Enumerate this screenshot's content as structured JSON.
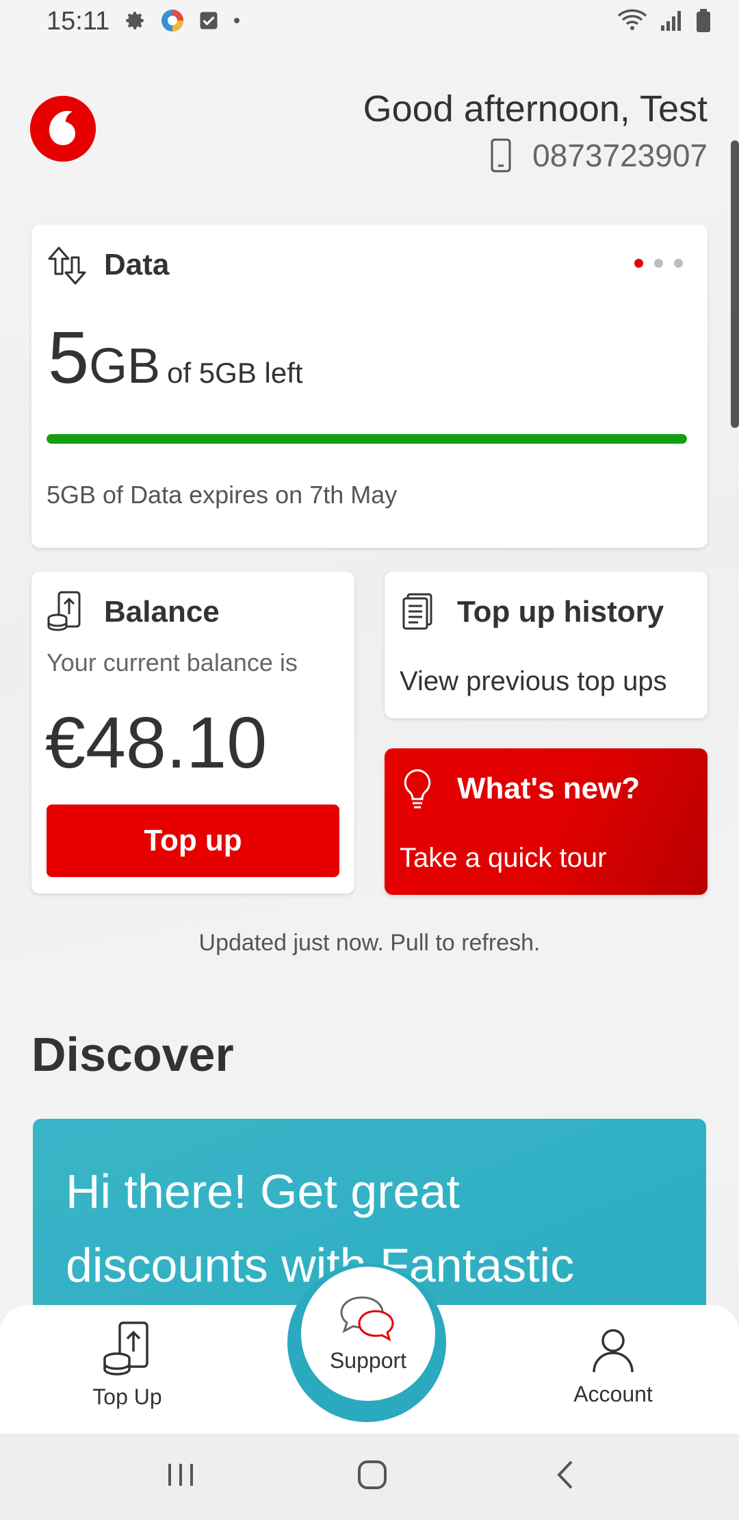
{
  "status_bar": {
    "time": "15:11",
    "icons_left": [
      "gear-icon",
      "app-icon",
      "checkbox-icon",
      "dot-icon"
    ],
    "icons_right": [
      "wifi-icon",
      "signal-icon",
      "battery-icon"
    ]
  },
  "header": {
    "greeting": "Good afternoon, Test",
    "phone_number": "0873723907",
    "brand_color": "#e60000"
  },
  "data_card": {
    "title": "Data",
    "remaining_value": "5",
    "remaining_unit": "GB",
    "of_total": "of 5GB left",
    "progress_fraction": 1.0,
    "progress_color": "#12a012",
    "expires_text": "5GB of Data expires on 7th May",
    "pager_count": 3,
    "pager_active": 0
  },
  "balance_card": {
    "title": "Balance",
    "subtitle": "Your current balance is",
    "amount": "€48.10",
    "button_label": "Top up"
  },
  "history_card": {
    "title": "Top up history",
    "subtitle": "View previous top ups"
  },
  "whatsnew_card": {
    "title": "What's new?",
    "subtitle": "Take a quick tour"
  },
  "refresh_text": "Updated just now. Pull to refresh.",
  "discover": {
    "title": "Discover",
    "promo_text": "Hi there! Get great discounts with Fantastic"
  },
  "bottom_nav": {
    "items": [
      {
        "label": "Top Up",
        "icon": "phone-topup-icon"
      },
      {
        "label": "Support",
        "icon": "chat-bubbles-icon"
      },
      {
        "label": "Account",
        "icon": "person-icon"
      }
    ],
    "support_color": "#2aa9bf"
  },
  "system_nav": [
    "recents-button",
    "home-button",
    "back-button"
  ]
}
